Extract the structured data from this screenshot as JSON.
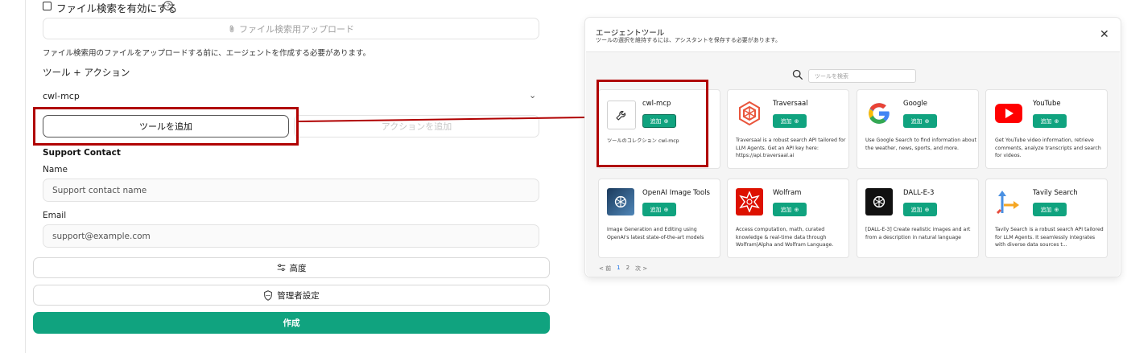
{
  "left_panel": {
    "file_search_label": "ファイル検索を有効にする",
    "upload_label": "ファイル検索用アップロード",
    "upload_note": "ファイル検索用のファイルをアップロードする前に、エージェントを作成する必要があります。",
    "tools_heading": "ツール + アクション",
    "selected_tool": "cwl-mcp",
    "add_tool_label": "ツールを追加",
    "add_action_label": "アクションを追加",
    "support_contact_heading": "Support Contact",
    "name_label": "Name",
    "name_placeholder": "Support contact name",
    "email_label": "Email",
    "email_placeholder": "support@example.com",
    "advanced_label": "高度",
    "admin_label": "管理者設定",
    "create_label": "作成"
  },
  "dialog": {
    "title": "エージェントツール",
    "subtitle": "ツールの選択を維持するには、アシスタントを保存する必要があります。",
    "search_placeholder": "ツールを検索",
    "add_label": "追加",
    "tools": [
      {
        "name": "cwl-mcp",
        "desc": "ツールのコレクション cwl-mcp",
        "icon": "wrench-icon"
      },
      {
        "name": "Traversaal",
        "desc": "Traversaal is a robust search API tailored for LLM Agents. Get an API key here: https://api.traversaal.ai",
        "icon": "traversaal-logo-icon"
      },
      {
        "name": "Google",
        "desc": "Use Google Search to find information about the weather, news, sports, and more.",
        "icon": "google-logo-icon"
      },
      {
        "name": "YouTube",
        "desc": "Get YouTube video information, retrieve comments, analyze transcripts and search for videos.",
        "icon": "youtube-logo-icon"
      },
      {
        "name": "OpenAI Image Tools",
        "desc": "Image Generation and Editing using OpenAI's latest state-of-the-art models",
        "icon": "openai-image-tools-icon"
      },
      {
        "name": "Wolfram",
        "desc": "Access computation, math, curated knowledge & real-time data through Wolfram|Alpha and Wolfram Language.",
        "icon": "wolfram-logo-icon"
      },
      {
        "name": "DALL-E-3",
        "desc": "[DALL-E-3] Create realistic images and art from a description in natural language",
        "icon": "openai-logo-icon"
      },
      {
        "name": "Tavily Search",
        "desc": "Tavily Search is a robust search API tailored for LLM Agents. It seamlessly integrates with diverse data sources t...",
        "icon": "tavily-logo-icon"
      }
    ],
    "pager": {
      "prev": "< 前",
      "page1": "1",
      "page2": "2",
      "next": "次 >"
    }
  },
  "colors": {
    "accent": "#10a37f",
    "highlight": "#b00000"
  }
}
